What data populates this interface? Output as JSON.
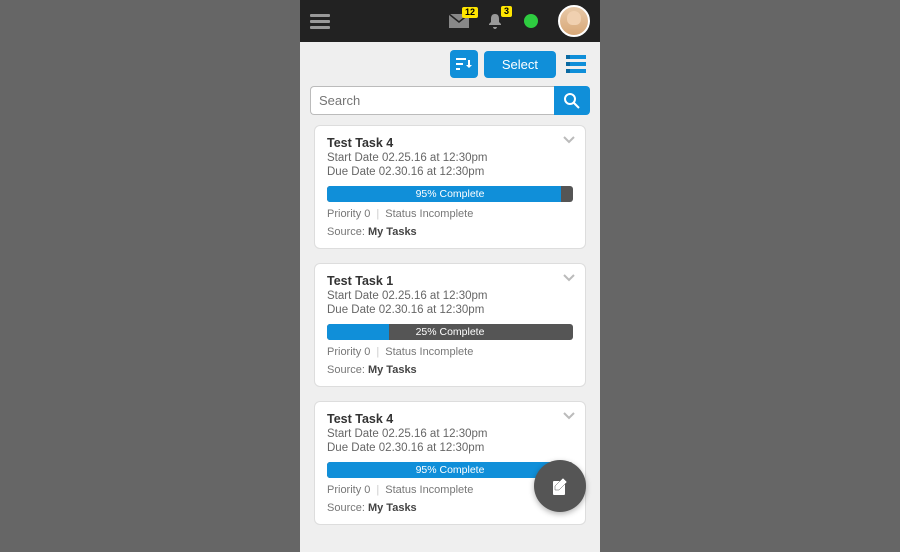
{
  "header": {
    "inbox_badge": "12",
    "alerts_badge": "3"
  },
  "toolbar": {
    "select_label": "Select"
  },
  "search": {
    "placeholder": "Search",
    "value": ""
  },
  "labels": {
    "start_prefix": "Start Date ",
    "due_prefix": "Due Date ",
    "priority_prefix": "Priority ",
    "status_prefix": "Status ",
    "source_prefix": "Source: ",
    "complete_suffix": "% Complete"
  },
  "tasks": [
    {
      "title": "Test Task 4",
      "start": "02.25.16 at 12:30pm",
      "due": "02.30.16 at 12:30pm",
      "progress": 95,
      "priority": "0",
      "status": "Incomplete",
      "source": "My Tasks"
    },
    {
      "title": "Test Task 1",
      "start": "02.25.16 at 12:30pm",
      "due": "02.30.16 at 12:30pm",
      "progress": 25,
      "priority": "0",
      "status": "Incomplete",
      "source": "My Tasks"
    },
    {
      "title": "Test Task 4",
      "start": "02.25.16 at 12:30pm",
      "due": "02.30.16 at 12:30pm",
      "progress": 95,
      "priority": "0",
      "status": "Incomplete",
      "source": "My Tasks"
    }
  ],
  "colors": {
    "accent": "#108fd9",
    "header_bg": "#222222",
    "page_bg": "#efefef",
    "badge_bg": "#ffe600",
    "presence": "#2ecc40"
  }
}
